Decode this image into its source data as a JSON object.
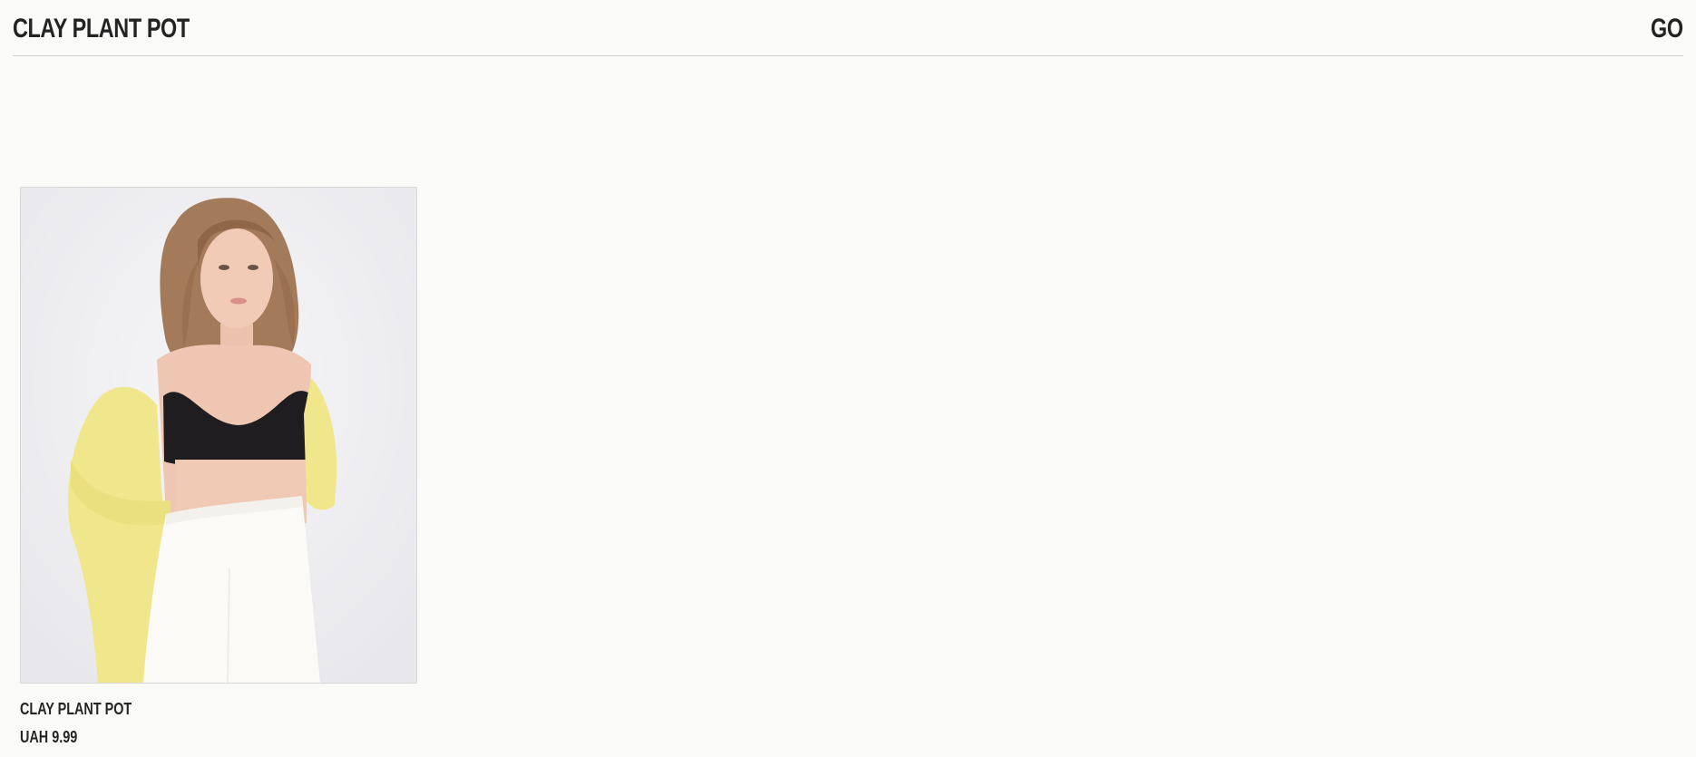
{
  "header": {
    "brand": "CLAY PLANT POT",
    "go_label": "GO"
  },
  "products": [
    {
      "name": "CLAY PLANT POT",
      "price": "UAH 9.99",
      "image_alt": "Model wearing yellow cardigan, black crop top and white trousers"
    }
  ]
}
